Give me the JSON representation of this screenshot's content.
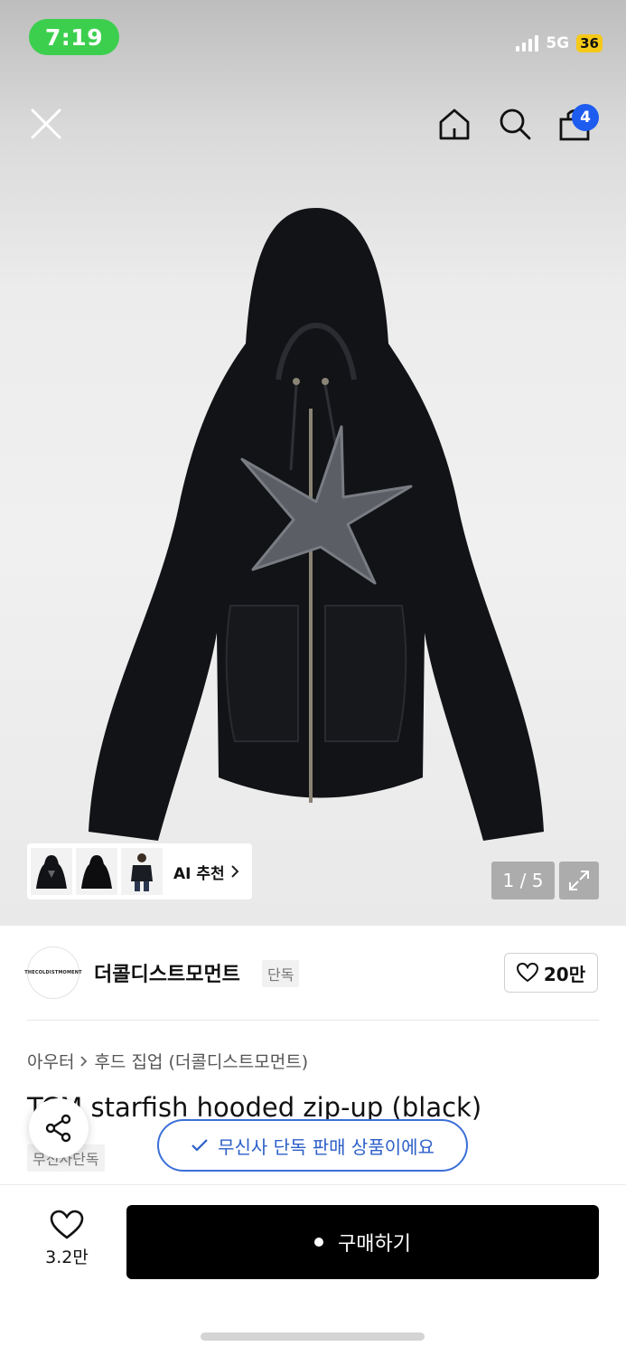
{
  "status_bar": {
    "time": "7:19",
    "network": "5G",
    "battery": "36"
  },
  "header": {
    "cart_count": "4"
  },
  "gallery": {
    "ai_recommend_label": "AI 추천",
    "counter": "1 / 5"
  },
  "brand": {
    "logo_text": "THECOLDISTMOMENT",
    "name": "더콜디스트모먼트",
    "exclusive_tag": "단독",
    "likes": "20만"
  },
  "product": {
    "category": "아우터",
    "subcategory": "후드 집업 (더콜디스트모먼트)",
    "title": "TCM starfish hooded zip-up (black)",
    "tag": "무신사단독"
  },
  "toast": {
    "message": "무신사 단독 판매 상품이에요"
  },
  "bottom": {
    "wish_count": "3.2만",
    "buy_label": "구매하기"
  },
  "colors": {
    "accent": "#1e5cf0",
    "toast_border": "#3b6fd8",
    "status_green": "#3ccf4e",
    "battery": "#f5c918"
  }
}
